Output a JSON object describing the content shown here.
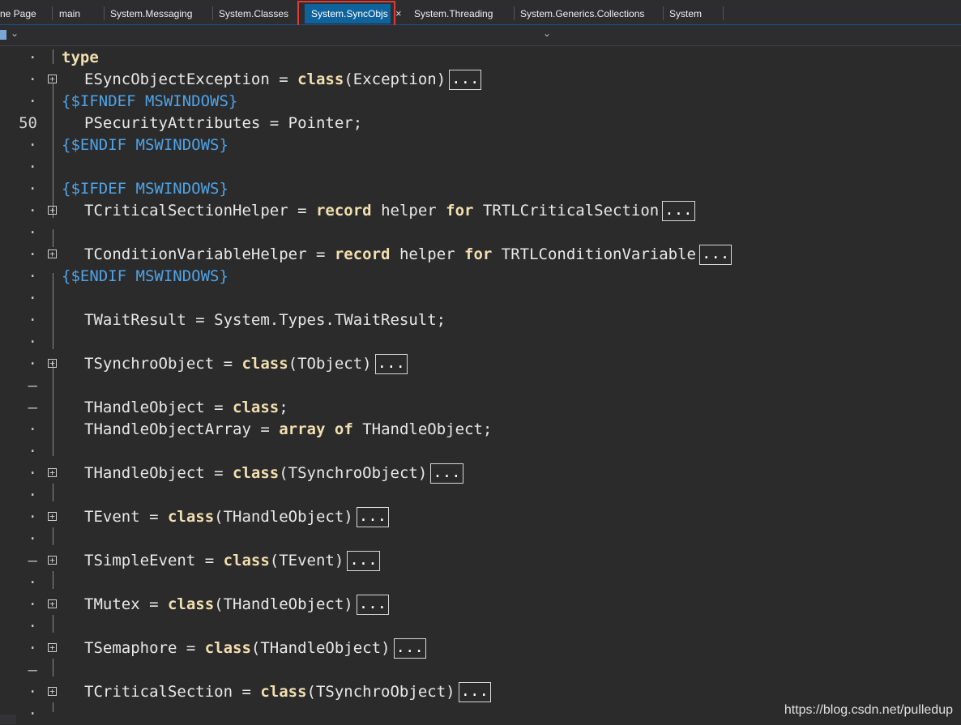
{
  "tabs": [
    {
      "label": "ne Page",
      "active": false
    },
    {
      "label": "main",
      "active": false
    },
    {
      "label": "System.Messaging",
      "active": false
    },
    {
      "label": "System.Classes",
      "active": false
    },
    {
      "label": "System.SyncObjs",
      "active": true
    },
    {
      "label": "System.Threading",
      "active": false
    },
    {
      "label": "System.Generics.Collections",
      "active": false
    },
    {
      "label": "System",
      "active": false
    }
  ],
  "tab_close_glyph": "×",
  "colors": {
    "active_tab": "#0e639c",
    "highlight_box": "#e53935",
    "keyword": "#f2dfb0",
    "directive": "#4fa3e8",
    "text": "#e8e8e8",
    "background": "#2b2b2b"
  },
  "icons": {
    "file_icon": "file-icon",
    "dropdown": "chevron-down-icon",
    "fold": "fold-expand-icon"
  },
  "collapsed_marker": "...",
  "gutter": {
    "l01": "·",
    "l02": "·",
    "l03": "·",
    "l04": "50",
    "l05": "·",
    "l06": "·",
    "l07": "·",
    "l08": "·",
    "l09": "·",
    "l10": "·",
    "l11": "·",
    "l12": "·",
    "l13": "·",
    "l14": "·",
    "l15": "·",
    "l16": "–",
    "l17": "–",
    "l18": "·",
    "l19": "·",
    "l20": "·",
    "l21": "·",
    "l22": "·",
    "l23": "·",
    "l24": "–",
    "l25": "·",
    "l26": "·",
    "l27": "·",
    "l28": "·",
    "l29": "–",
    "l30": "·",
    "l31": "·"
  },
  "code": {
    "l01": {
      "kw": "type"
    },
    "l02": {
      "a": "ESyncObjectException = ",
      "kw": "class",
      "b": "(Exception)"
    },
    "l03": {
      "dir": "{$IFNDEF MSWINDOWS}"
    },
    "l04": {
      "a": "PSecurityAttributes = Pointer;"
    },
    "l05": {
      "dir": "{$ENDIF MSWINDOWS}"
    },
    "l07": {
      "dir": "{$IFDEF MSWINDOWS}"
    },
    "l08": {
      "a": "TCriticalSectionHelper = ",
      "kw": "record",
      "b": " helper ",
      "kw2": "for",
      "c": " TRTLCriticalSection"
    },
    "l10": {
      "a": "TConditionVariableHelper = ",
      "kw": "record",
      "b": " helper ",
      "kw2": "for",
      "c": " TRTLConditionVariable"
    },
    "l11": {
      "dir": "{$ENDIF MSWINDOWS}"
    },
    "l13": {
      "a": "TWaitResult = System.Types.TWaitResult;"
    },
    "l15": {
      "a": "TSynchroObject = ",
      "kw": "class",
      "b": "(TObject)"
    },
    "l17": {
      "a": "THandleObject = ",
      "kw": "class",
      "b": ";"
    },
    "l18": {
      "a": "THandleObjectArray = ",
      "kw": "array",
      "b": " ",
      "kw2": "of",
      "c": " THandleObject;"
    },
    "l20": {
      "a": "THandleObject = ",
      "kw": "class",
      "b": "(TSynchroObject)"
    },
    "l22": {
      "a": "TEvent = ",
      "kw": "class",
      "b": "(THandleObject)"
    },
    "l24": {
      "a": "TSimpleEvent = ",
      "kw": "class",
      "b": "(TEvent)"
    },
    "l26": {
      "a": "TMutex = ",
      "kw": "class",
      "b": "(THandleObject)"
    },
    "l28": {
      "a": "TSemaphore = ",
      "kw": "class",
      "b": "(THandleObject)"
    },
    "l30": {
      "a": "TCriticalSection = ",
      "kw": "class",
      "b": "(TSynchroObject)"
    }
  },
  "watermark": "https://blog.csdn.net/pulledup"
}
